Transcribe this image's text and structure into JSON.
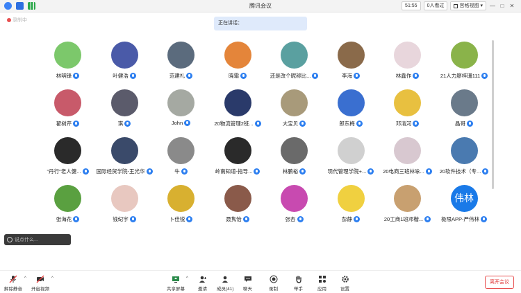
{
  "window": {
    "title": "腾讯会议",
    "timer": "51:55",
    "viewers": "0人看过",
    "view_mode": "宫格视图",
    "colors": {
      "accent": "#2d7ff0",
      "leave": "#e85050"
    }
  },
  "status": {
    "recording_label": "录制中",
    "speaking_label": "正在讲话："
  },
  "participants": [
    {
      "name": "林明锋",
      "bg": "#7cc86b"
    },
    {
      "name": "叶健浩",
      "bg": "#4a5aa8"
    },
    {
      "name": "范建礼",
      "bg": "#5b6b7d"
    },
    {
      "name": "晓霜",
      "bg": "#e4853a"
    },
    {
      "name": "还是改个昵称比...",
      "bg": "#5aa0a0"
    },
    {
      "name": "李海",
      "bg": "#8a6a4a"
    },
    {
      "name": "林鑫作",
      "bg": "#e8d6dc"
    },
    {
      "name": "21人力廖梓珊111",
      "bg": "#8ab34a"
    },
    {
      "name": "翟树芹",
      "bg": "#c85a6a"
    },
    {
      "name": "琪",
      "bg": "#5b5b6b"
    },
    {
      "name": "John",
      "bg": "#a5a9a2"
    },
    {
      "name": "20物流管理2班...",
      "bg": "#2a3a6a"
    },
    {
      "name": "大宝贝",
      "bg": "#a89a7a"
    },
    {
      "name": "郎东梅",
      "bg": "#3a6fd0"
    },
    {
      "name": "邓清河",
      "bg": "#e8c040"
    },
    {
      "name": "晶哥",
      "bg": "#6a7a8a"
    },
    {
      "name": "\"丹行\"老人健...",
      "bg": "#2a2a2a"
    },
    {
      "name": "国际经贸学院-王光华",
      "bg": "#3a4a6a"
    },
    {
      "name": "牛",
      "bg": "#8a8a8a"
    },
    {
      "name": "岭南知道-指导...",
      "bg": "#2a2a2a"
    },
    {
      "name": "林鹏裕",
      "bg": "#6a6a6a"
    },
    {
      "name": "现代管理学院+...",
      "bg": "#d0d0d0"
    },
    {
      "name": "20电商三班林咏...",
      "bg": "#d8c8d0"
    },
    {
      "name": "20软件技术（专...",
      "bg": "#4a7ab0"
    },
    {
      "name": "张海花",
      "bg": "#5aa040"
    },
    {
      "name": "钱纪宇",
      "bg": "#e8c8c0"
    },
    {
      "name": "卜佳锐",
      "bg": "#d8b030"
    },
    {
      "name": "聂隽怡",
      "bg": "#8a5a4a"
    },
    {
      "name": "张杏",
      "bg": "#c84ab0"
    },
    {
      "name": "彭静",
      "bg": "#f0d040"
    },
    {
      "name": "20工商1班邓楷...",
      "bg": "#c8a070"
    },
    {
      "name": "极限APP-严伟林",
      "bg": "#1a7ae8",
      "initials": "伟林"
    }
  ],
  "chat": {
    "placeholder": "说点什么..."
  },
  "toolbar": {
    "mute": "解除静音",
    "video": "开启视频",
    "share": "共享屏幕",
    "invite": "邀请",
    "members": "成员(41)",
    "chat": "聊天",
    "record": "录制",
    "raise_hand": "举手",
    "apps": "应用",
    "settings": "设置",
    "leave": "离开会议"
  }
}
